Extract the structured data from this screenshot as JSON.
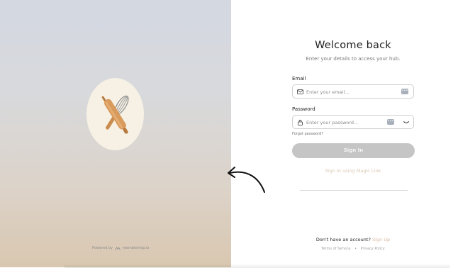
{
  "brand": {
    "logo_icon": "rolling-pin-whisk-icon",
    "powered_by": "Powered by",
    "powered_brand": "membership.io"
  },
  "login": {
    "title": "Welcome back",
    "subtitle": "Enter your details to access your hub.",
    "email_label": "Email",
    "email_placeholder": "Enter your email...",
    "password_label": "Password",
    "password_placeholder": "Enter your password...",
    "forgot_password": "Forgot password?",
    "sign_in_button": "Sign In",
    "magic_link": "Sign In using Magic Link",
    "no_account_text": "Don't have an account?",
    "sign_up_link": "Sign Up",
    "terms_link": "Terms of Service",
    "separator": "•",
    "privacy_link": "Privacy Policy"
  },
  "colors": {
    "accent_link": "#d9b8a3",
    "button_disabled": "#c5c5c5"
  }
}
